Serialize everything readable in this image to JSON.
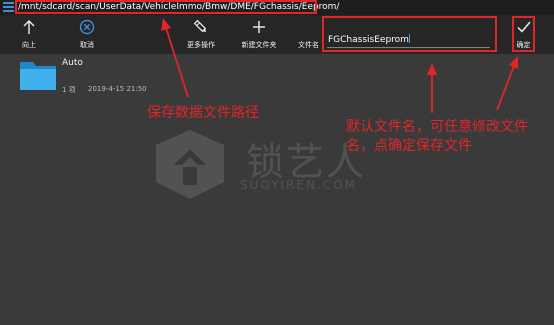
{
  "path_bar": {
    "path": "/mnt/sdcard/scan/UserData/VehicleImmo/Bmw/DME/FGchassis/Eeprom/"
  },
  "toolbar": {
    "up": {
      "label": "向上",
      "icon": "arrow-up-icon"
    },
    "cancel": {
      "label": "取消",
      "icon": "cancel-circle-icon"
    },
    "more": {
      "label": "更多操作",
      "icon": "edit-pencil-icon"
    },
    "new_folder": {
      "label": "新建文件夹",
      "icon": "plus-icon"
    },
    "filename_label": "文件名",
    "filename_value": "FGChassisEeprom",
    "confirm": {
      "label": "确定",
      "icon": "checkmark-icon"
    }
  },
  "files": [
    {
      "name": "Auto",
      "count": "1 项",
      "date": "2019-4-15 21:50",
      "icon": "folder-icon"
    }
  ],
  "watermark": {
    "brand": "锁艺人",
    "site": "SUOYIREN.COM"
  },
  "annotations": {
    "path_note": "保存数据文件路径",
    "name_note": "默认文件名，可任意修改文件名，点确定保存文件"
  },
  "colors": {
    "annotation_red": "#e0262a",
    "accent_blue": "#3d8fd6",
    "folder_blue": "#29a3e3",
    "background": "#3a3a3a",
    "toolbar": "#262626"
  }
}
